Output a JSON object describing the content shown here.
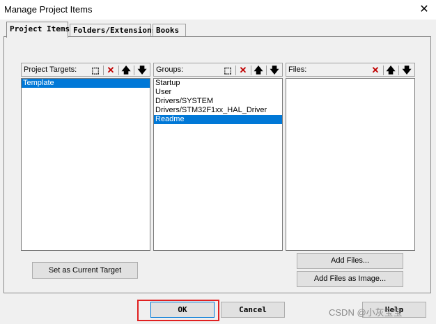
{
  "window": {
    "title": "Manage Project Items",
    "close_glyph": "✕"
  },
  "tabs": [
    {
      "label": "Project Items",
      "active": true
    },
    {
      "label": "Folders/Extensions",
      "active": false
    },
    {
      "label": "Books",
      "active": false
    }
  ],
  "targets": {
    "label": "Project Targets:",
    "items": [
      "Template"
    ],
    "selected_index": 0
  },
  "groups": {
    "label": "Groups:",
    "items": [
      "Startup",
      "User",
      "Drivers/SYSTEM",
      "Drivers/STM32F1xx_HAL_Driver",
      "Readme"
    ],
    "selected_index": 4
  },
  "files": {
    "label": "Files:",
    "items": []
  },
  "toolbar_icons": {
    "new": "new-item-icon",
    "delete": "delete-icon",
    "up": "move-up-icon",
    "down": "move-down-icon"
  },
  "buttons": {
    "set_current_target": "Set as Current Target",
    "add_files": "Add Files...",
    "add_files_image": "Add Files as Image...",
    "ok": "OK",
    "cancel": "Cancel",
    "help": "Help"
  },
  "watermark": "CSDN @小灰宝宝",
  "colors": {
    "selection": "#0078d7",
    "delete_icon": "#c00000",
    "highlight_box": "#e02020"
  }
}
